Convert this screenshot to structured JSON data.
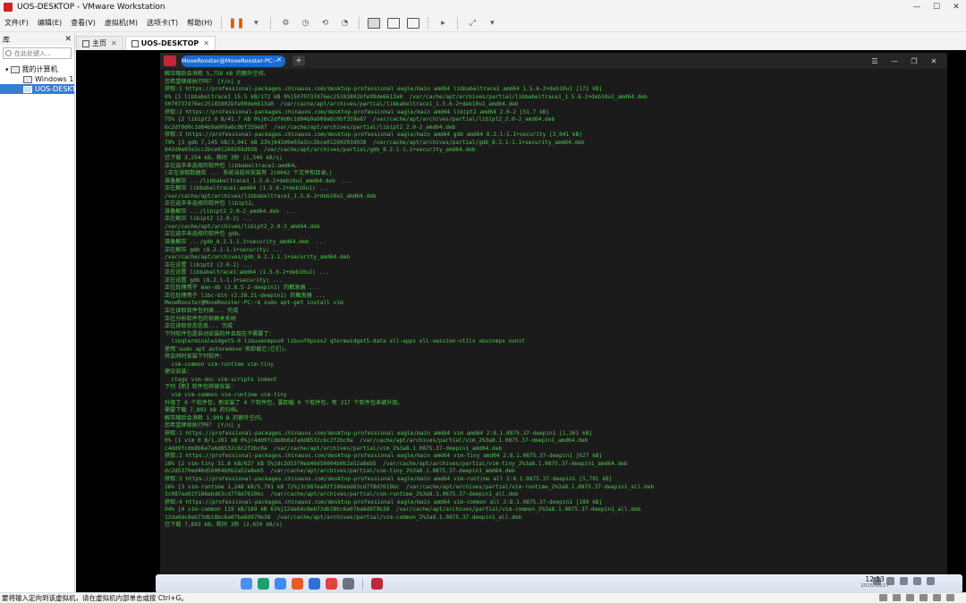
{
  "window": {
    "title": "UOS-DESKTOP - VMware Workstation",
    "controls": [
      "—",
      "☐",
      "✕"
    ]
  },
  "menu": {
    "items": [
      "文件(F)",
      "编辑(E)",
      "查看(V)",
      "虚拟机(M)",
      "选项卡(T)",
      "帮助(H)"
    ]
  },
  "library": {
    "title": "库",
    "close": "✕",
    "search_placeholder": "在此处键入...",
    "root": "我的计算机",
    "vms": [
      "Windows 10",
      "UOS-DESKTOP"
    ]
  },
  "tabs": [
    {
      "label": "主页"
    },
    {
      "label": "UOS-DESKTOP"
    }
  ],
  "terminal": {
    "tab_title": "MooeRooster@MooeRooster-PC:~",
    "add": "+",
    "lines": [
      "解压缩后会消耗 5,758 kB 的额外空间。",
      "您希望继续执行吗？ [Y/n] y",
      "获取:1 https://professional-packages.chinauos.com/desktop-professional eagle/main amd64 libbabeltrace1 amd64 1.5.6-2+deb10u1 [172 kB]",
      "0% [1 libbabeltrace1 15.5 kB/172 kB 9%]5070737d76ec25183802bfe99de6613a0  /var/cache/apt/archives/partial/libbabeltrace1_1.5.6-2+deb10u1_amd64.deb",
      "5070737d76ec25183802bfe99de6613a0  /var/cache/apt/archives/partial/libbabeltrace1_1.5.6-2+deb10u1_amd64.deb",
      "获取:2 https://professional-packages.chinauos.com/desktop-professional eagle/main amd64 libipt2 amd64 2.0-2 [51.7 kB]",
      "75% [2 libipt2 0 B/41.7 kB 0%]6c2df0d0c1d04b9a909a6c0bf359e87  /var/cache/apt/archives/partial/libipt2_2.0-2_amd64.deb",
      "6c2df0d0c1d04b9a909a6c0bf359e87  /var/cache/apt/archives/partial/libipt2_2.0-2_amd64.deb",
      "获取:3 https://professional-packages.chinauos.com/desktop-professional eagle/main amd64 gdb amd64 8.2.1-1.1+security [3,041 kB]",
      "79% [3 gdb 7,145 kB/3,041 kB 23%]843d9e03e3cc2bce01260203d938  /var/cache/apt/archives/partial/gdb_8.2.1-1.1+security_amd64.deb",
      "843d9e03e3cc2bce01260203d938  /var/cache/apt/archives/partial/gdb_8.2.1-1.1+security_amd64.deb",
      "已下载 3,254 kB，耗时 3秒 (1,540 kB/s)",
      "正在选中未选择的软件包 libbabeltrace1:amd64。",
      "(正在读取数据库 ... 系统当前共安装有 210042 个文件和目录。)",
      "准备解压 .../libbabeltrace1_1.5.6-2+deb10u1_amd64.deb  ...",
      "正在解压 libbabeltrace1:amd64 (1.5.6-2+deb10u1) ...",
      "/var/cache/apt/archives/libbabeltrace1_1.5.6-2+deb10u1_amd64.deb",
      "正在选中未选择的软件包 libipt2。",
      "准备解压 .../libipt2_2.0-2_amd64.deb  ...",
      "正在解压 libipt2 (2.0-2) ...",
      "/var/cache/apt/archives/libipt2_2.0-2_amd64.deb",
      "正在选中未选择的软件包 gdb。",
      "准备解压 .../gdb_8.2.1-1.1+security_amd64.deb  ...",
      "正在解压 gdb (8.2.1-1.1+security) ...",
      "/var/cache/apt/archives/gdb_8.2.1-1.1+security_amd64.deb",
      "正在设置 libipt2 (2.0-2) ...",
      "正在设置 libbabeltrace1:amd64 (1.5.6-2+deb10u1) ...",
      "正在设置 gdb (8.2.1-1.1+security) ...",
      "正在处理用于 man-db (2.8.5-2-deepin1) 的触发器 ...",
      "正在处理用于 libc-bin (2.28.21-deepin1) 的触发器 ...",
      "MooeRooster@MooeRooster-PC:~$ sudo apt-get install vim",
      "正在读取软件包列表... 完成",
      "正在分析软件包的依赖关系树",
      "正在读取状态信息... 完成",
      "下列软件包是自动安装的并且现在不需要了：",
      "  libqterminalwidget5-0 libuuenmpos0 libuuf0pcos2 qtermwidget5-data xll-apps xll-session-utils xbuinmps xunit",
      "使用'sudo apt autoremove'来卸载它(它们)。",
      "将会同时安装下列软件：",
      "  vim-common vim-runtime vim-tiny",
      "建议安装：",
      "  ctags vim-doc vim-scripts indent",
      "下列【新】软件包将被安装：",
      "  vim vim-common vim-runtime vim-tiny",
      "升级了 0 个软件包，新安装了 4 个软件包，要卸载 0 个软件包，有 217 个软件包未被升级。",
      "需要下载 7,893 kB 的归档。",
      "解压缩后会消耗 1,999 B 的额外空间。",
      "您希望继续执行吗？ [Y/n] y",
      "获取:1 https://professional-packages.chinauos.com/desktop-professional eagle/main amd64 vim amd64 2:8.1.0875.37-deepin1 [1,261 kB]",
      "0% [1 vim 0 B/1,261 kB 0%]c4dd9fcdb8b6e7a6d8532c6c2f2bc0a  /var/cache/apt/archives/partial/vim_2%3a8.1.0875.37-deepin1_amd64.deb",
      "c4dd9fcdb8b6e7a6d8532c6c2f2bc0a  /var/cache/apt/archives/partial/vim_2%3a8.1.0875.37-deepin1_amd64.deb",
      "获取:2 https://professional-packages.chinauos.com/desktop-professional eagle/main amd64 vim-tiny amd64 2:8.1.0875.37-deepin1 [627 kB]",
      "18% [2 vim-tiny 31.8 kB/627 kB 5%]dc2d5370ed46d56004b0b2a52a8eb5  /var/cache/apt/archives/partial/vim-tiny_2%3a8.1.0875.37-deepin1_amd64.deb",
      "dc2d5370ed46d56004b0b2a52a8eb5  /var/cache/apt/archives/partial/vim-tiny_2%3a8.1.0875.37-deepin1_amd64.deb",
      "获取:3 https://professional-packages.chinauos.com/desktop-professional eagle/main amd64 vim-runtime all 2:8.1.0875.37-deepin1 [5,791 kB]",
      "26% [3 vim-runtime 1,248 kB/5,791 kB 72%]3c987ea02f186ebd63cd778d7619bc  /var/cache/apt/archives/partial/vim-runtime_2%3a8.1.0875.37-deepin1_all.deb",
      "3c987ea02f186ebd63cd778d7619bc  /var/cache/apt/archives/partial/vim-runtime_2%3a8.1.0875.37-deepin1_all.deb",
      "获取:4 https://professional-packages.chinauos.com/desktop-professional eagle/main amd64 vim-common all 2:8.1.0875.37-deepin1 [189 kB]",
      "94% [4 vim-common 119 kB/189 kB 63%]12da0dc8eb73db18bc6a07ba8d979b38  /var/cache/apt/archives/partial/vim-common_2%3a8.1.0875.37-deepin1_all.deb",
      "12da0dc8eb73db18bc6a07ba8d979b38  /var/cache/apt/archives/partial/vim-common_2%3a8.1.0875.37-deepin1_all.deb",
      "已下载 7,893 kB，耗时 3秒 (2,650 kB/s)"
    ]
  },
  "dock": {
    "apps": [
      {
        "name": "launcher",
        "color": "#4a8ef0"
      },
      {
        "name": "multitasking",
        "color": "#1e9e6e"
      },
      {
        "name": "file-manager",
        "color": "#3d8cf0"
      },
      {
        "name": "app-store",
        "color": "#e85a2a"
      },
      {
        "name": "browser",
        "color": "#2d6fd6"
      },
      {
        "name": "music",
        "color": "#e8403a"
      },
      {
        "name": "settings",
        "color": "#6b7280"
      }
    ],
    "terminal_app_color": "#c0273b",
    "time": "12:13",
    "date": "2025/10/27"
  },
  "statusbar": {
    "text": "要将输入定向到该虚拟机，请在虚拟机内部单击或按 Ctrl+G。"
  }
}
